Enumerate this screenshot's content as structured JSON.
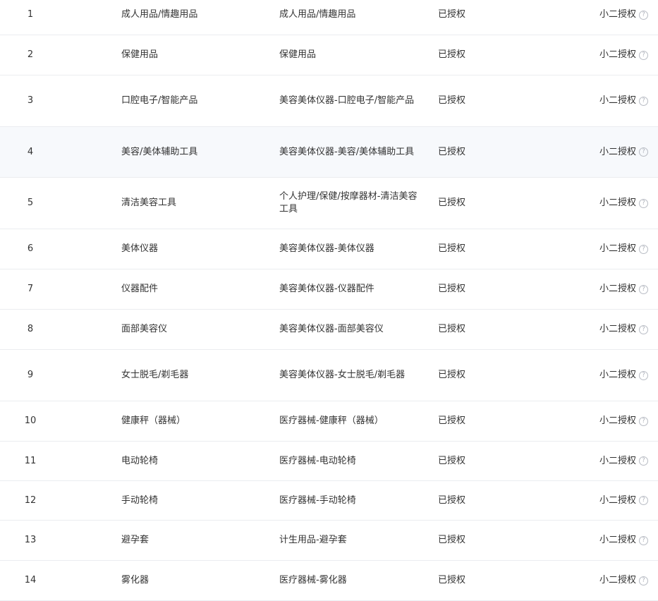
{
  "rows": [
    {
      "index": "1",
      "name": "成人用品/情趣用品",
      "path": "成人用品/情趣用品",
      "status": "已授权",
      "auth_type": "小二授权",
      "help_icon": "help-circle-icon"
    },
    {
      "index": "2",
      "name": "保健用品",
      "path": "保健用品",
      "status": "已授权",
      "auth_type": "小二授权",
      "help_icon": "help-circle-icon"
    },
    {
      "index": "3",
      "name": "口腔电子/智能产品",
      "path": "美容美体仪器-口腔电子/智能产品",
      "status": "已授权",
      "auth_type": "小二授权",
      "help_icon": "help-circle-icon"
    },
    {
      "index": "4",
      "name": "美容/美体辅助工具",
      "path": "美容美体仪器-美容/美体辅助工具",
      "status": "已授权",
      "auth_type": "小二授权",
      "help_icon": "help-circle-icon"
    },
    {
      "index": "5",
      "name": "清洁美容工具",
      "path": "个人护理/保健/按摩器材-清洁美容工具",
      "status": "已授权",
      "auth_type": "小二授权",
      "help_icon": "help-circle-icon"
    },
    {
      "index": "6",
      "name": "美体仪器",
      "path": "美容美体仪器-美体仪器",
      "status": "已授权",
      "auth_type": "小二授权",
      "help_icon": "help-circle-icon"
    },
    {
      "index": "7",
      "name": "仪器配件",
      "path": "美容美体仪器-仪器配件",
      "status": "已授权",
      "auth_type": "小二授权",
      "help_icon": "help-circle-icon"
    },
    {
      "index": "8",
      "name": "面部美容仪",
      "path": "美容美体仪器-面部美容仪",
      "status": "已授权",
      "auth_type": "小二授权",
      "help_icon": "help-circle-icon"
    },
    {
      "index": "9",
      "name": "女士脱毛/剃毛器",
      "path": "美容美体仪器-女士脱毛/剃毛器",
      "status": "已授权",
      "auth_type": "小二授权",
      "help_icon": "help-circle-icon"
    },
    {
      "index": "10",
      "name": "健康秤（器械）",
      "path": "医疗器械-健康秤（器械）",
      "status": "已授权",
      "auth_type": "小二授权",
      "help_icon": "help-circle-icon"
    },
    {
      "index": "11",
      "name": "电动轮椅",
      "path": "医疗器械-电动轮椅",
      "status": "已授权",
      "auth_type": "小二授权",
      "help_icon": "help-circle-icon"
    },
    {
      "index": "12",
      "name": "手动轮椅",
      "path": "医疗器械-手动轮椅",
      "status": "已授权",
      "auth_type": "小二授权",
      "help_icon": "help-circle-icon"
    },
    {
      "index": "13",
      "name": "避孕套",
      "path": "计生用品-避孕套",
      "status": "已授权",
      "auth_type": "小二授权",
      "help_icon": "help-circle-icon"
    },
    {
      "index": "14",
      "name": "雾化器",
      "path": "医疗器械-雾化器",
      "status": "已授权",
      "auth_type": "小二授权",
      "help_icon": "help-circle-icon"
    }
  ],
  "colors": {
    "text": "#333333",
    "row_border": "#ebedf0",
    "row_highlight": "#f7f9fc",
    "help_icon": "#b0b4bc"
  }
}
